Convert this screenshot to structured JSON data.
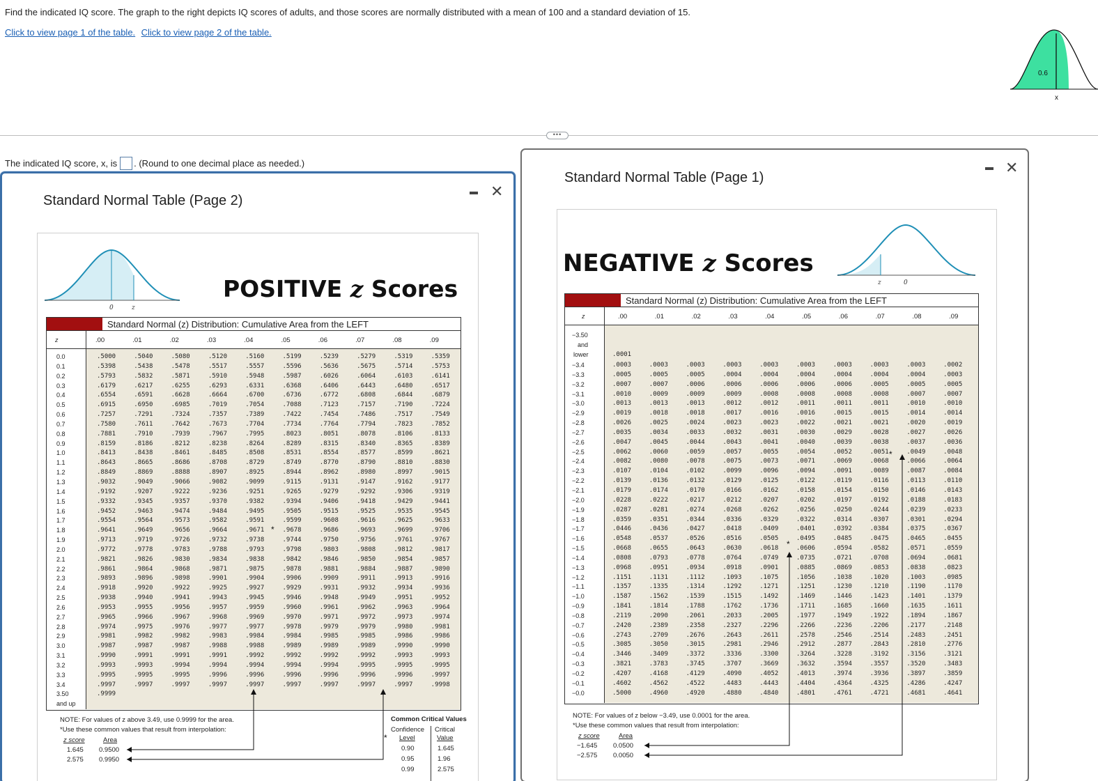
{
  "question": {
    "text": "Find the indicated IQ score. The graph to the right depicts IQ scores of adults, and those scores are normally distributed with a mean of 100 and a standard deviation of 15.",
    "link1": "Click to view page 1 of the table.",
    "link2": "Click to view page 2 of the table.",
    "graph_area_label": "0.6",
    "graph_x_label": "x",
    "answer_prefix": "The indicated IQ score, x, is",
    "answer_suffix": ". (Round to one decimal place as needed.)",
    "more_label": "•••"
  },
  "colors": {
    "accent_green": "#3de0a0",
    "link_blue": "#1a5fb4",
    "band_red": "#a20f10",
    "curve_blue": "#1f8fb6"
  },
  "page2": {
    "title": "Standard Normal Table (Page 2)",
    "heading_word": "POSITIVE",
    "heading_z": "z",
    "heading_tail": "Scores",
    "band_text": "Standard Normal (z) Distribution: Cumulative Area from the LEFT",
    "curve_label_0": "0",
    "curve_label_z": "z",
    "z_header": "z",
    "col_headers": [
      ".00",
      ".01",
      ".02",
      ".03",
      ".04",
      ".05",
      ".06",
      ".07",
      ".08",
      ".09"
    ],
    "z_values": [
      "0.0",
      "0.1",
      "0.2",
      "0.3",
      "0.4",
      "0.5",
      "0.6",
      "0.7",
      "0.8",
      "0.9",
      "1.0",
      "1.1",
      "1.2",
      "1.3",
      "1.4",
      "1.5",
      "1.6",
      "1.7",
      "1.8",
      "1.9",
      "2.0",
      "2.1",
      "2.2",
      "2.3",
      "2.4",
      "2.5",
      "2.6",
      "2.7",
      "2.8",
      "2.9",
      "3.0",
      "3.1",
      "3.2",
      "3.3",
      "3.4"
    ],
    "rows": [
      [
        ".5000",
        ".5040",
        ".5080",
        ".5120",
        ".5160",
        ".5199",
        ".5239",
        ".5279",
        ".5319",
        ".5359"
      ],
      [
        ".5398",
        ".5438",
        ".5478",
        ".5517",
        ".5557",
        ".5596",
        ".5636",
        ".5675",
        ".5714",
        ".5753"
      ],
      [
        ".5793",
        ".5832",
        ".5871",
        ".5910",
        ".5948",
        ".5987",
        ".6026",
        ".6064",
        ".6103",
        ".6141"
      ],
      [
        ".6179",
        ".6217",
        ".6255",
        ".6293",
        ".6331",
        ".6368",
        ".6406",
        ".6443",
        ".6480",
        ".6517"
      ],
      [
        ".6554",
        ".6591",
        ".6628",
        ".6664",
        ".6700",
        ".6736",
        ".6772",
        ".6808",
        ".6844",
        ".6879"
      ],
      [
        ".6915",
        ".6950",
        ".6985",
        ".7019",
        ".7054",
        ".7088",
        ".7123",
        ".7157",
        ".7190",
        ".7224"
      ],
      [
        ".7257",
        ".7291",
        ".7324",
        ".7357",
        ".7389",
        ".7422",
        ".7454",
        ".7486",
        ".7517",
        ".7549"
      ],
      [
        ".7580",
        ".7611",
        ".7642",
        ".7673",
        ".7704",
        ".7734",
        ".7764",
        ".7794",
        ".7823",
        ".7852"
      ],
      [
        ".7881",
        ".7910",
        ".7939",
        ".7967",
        ".7995",
        ".8023",
        ".8051",
        ".8078",
        ".8106",
        ".8133"
      ],
      [
        ".8159",
        ".8186",
        ".8212",
        ".8238",
        ".8264",
        ".8289",
        ".8315",
        ".8340",
        ".8365",
        ".8389"
      ],
      [
        ".8413",
        ".8438",
        ".8461",
        ".8485",
        ".8508",
        ".8531",
        ".8554",
        ".8577",
        ".8599",
        ".8621"
      ],
      [
        ".8643",
        ".8665",
        ".8686",
        ".8708",
        ".8729",
        ".8749",
        ".8770",
        ".8790",
        ".8810",
        ".8830"
      ],
      [
        ".8849",
        ".8869",
        ".8888",
        ".8907",
        ".8925",
        ".8944",
        ".8962",
        ".8980",
        ".8997",
        ".9015"
      ],
      [
        ".9032",
        ".9049",
        ".9066",
        ".9082",
        ".9099",
        ".9115",
        ".9131",
        ".9147",
        ".9162",
        ".9177"
      ],
      [
        ".9192",
        ".9207",
        ".9222",
        ".9236",
        ".9251",
        ".9265",
        ".9279",
        ".9292",
        ".9306",
        ".9319"
      ],
      [
        ".9332",
        ".9345",
        ".9357",
        ".9370",
        ".9382",
        ".9394",
        ".9406",
        ".9418",
        ".9429",
        ".9441"
      ],
      [
        ".9452",
        ".9463",
        ".9474",
        ".9484",
        ".9495",
        ".9505",
        ".9515",
        ".9525",
        ".9535",
        ".9545"
      ],
      [
        ".9554",
        ".9564",
        ".9573",
        ".9582",
        ".9591",
        ".9599",
        ".9608",
        ".9616",
        ".9625",
        ".9633"
      ],
      [
        ".9641",
        ".9649",
        ".9656",
        ".9664",
        ".9671",
        ".9678",
        ".9686",
        ".9693",
        ".9699",
        ".9706"
      ],
      [
        ".9713",
        ".9719",
        ".9726",
        ".9732",
        ".9738",
        ".9744",
        ".9750",
        ".9756",
        ".9761",
        ".9767"
      ],
      [
        ".9772",
        ".9778",
        ".9783",
        ".9788",
        ".9793",
        ".9798",
        ".9803",
        ".9808",
        ".9812",
        ".9817"
      ],
      [
        ".9821",
        ".9826",
        ".9830",
        ".9834",
        ".9838",
        ".9842",
        ".9846",
        ".9850",
        ".9854",
        ".9857"
      ],
      [
        ".9861",
        ".9864",
        ".9868",
        ".9871",
        ".9875",
        ".9878",
        ".9881",
        ".9884",
        ".9887",
        ".9890"
      ],
      [
        ".9893",
        ".9896",
        ".9898",
        ".9901",
        ".9904",
        ".9906",
        ".9909",
        ".9911",
        ".9913",
        ".9916"
      ],
      [
        ".9918",
        ".9920",
        ".9922",
        ".9925",
        ".9927",
        ".9929",
        ".9931",
        ".9932",
        ".9934",
        ".9936"
      ],
      [
        ".9938",
        ".9940",
        ".9941",
        ".9943",
        ".9945",
        ".9946",
        ".9948",
        ".9949",
        ".9951",
        ".9952"
      ],
      [
        ".9953",
        ".9955",
        ".9956",
        ".9957",
        ".9959",
        ".9960",
        ".9961",
        ".9962",
        ".9963",
        ".9964"
      ],
      [
        ".9965",
        ".9966",
        ".9967",
        ".9968",
        ".9969",
        ".9970",
        ".9971",
        ".9972",
        ".9973",
        ".9974"
      ],
      [
        ".9974",
        ".9975",
        ".9976",
        ".9977",
        ".9977",
        ".9978",
        ".9979",
        ".9979",
        ".9980",
        ".9981"
      ],
      [
        ".9981",
        ".9982",
        ".9982",
        ".9983",
        ".9984",
        ".9984",
        ".9985",
        ".9985",
        ".9986",
        ".9986"
      ],
      [
        ".9987",
        ".9987",
        ".9987",
        ".9988",
        ".9988",
        ".9989",
        ".9989",
        ".9989",
        ".9990",
        ".9990"
      ],
      [
        ".9990",
        ".9991",
        ".9991",
        ".9991",
        ".9992",
        ".9992",
        ".9992",
        ".9992",
        ".9993",
        ".9993"
      ],
      [
        ".9993",
        ".9993",
        ".9994",
        ".9994",
        ".9994",
        ".9994",
        ".9994",
        ".9995",
        ".9995",
        ".9995"
      ],
      [
        ".9995",
        ".9995",
        ".9995",
        ".9996",
        ".9996",
        ".9996",
        ".9996",
        ".9996",
        ".9996",
        ".9997"
      ],
      [
        ".9997",
        ".9997",
        ".9997",
        ".9997",
        ".9997",
        ".9997",
        ".9997",
        ".9997",
        ".9997",
        ".9998"
      ]
    ],
    "last_z": "3.50",
    "last_z2": "and up",
    "last_value": ".9999",
    "note": "NOTE: For values of z above 3.49, use 0.9999 for the area.",
    "note2": "*Use these common values that result from interpolation:",
    "interp_header_z": "z score",
    "interp_header_area": "Area",
    "interp": [
      [
        "1.645",
        "0.9500"
      ],
      [
        "2.575",
        "0.9950"
      ]
    ],
    "ccv_title": "Common Critical Values",
    "ccv_h1": "Confidence",
    "ccv_h1b": "Level",
    "ccv_h2": "Critical",
    "ccv_h2b": "Value",
    "ccv": [
      [
        "0.90",
        "1.645"
      ],
      [
        "0.95",
        "1.96"
      ],
      [
        "0.99",
        "2.575"
      ]
    ]
  },
  "page1": {
    "title": "Standard Normal Table (Page 1)",
    "heading_word": "NEGATIVE",
    "heading_z": "z",
    "heading_tail": "Scores",
    "band_text": "Standard Normal (z) Distribution: Cumulative Area from the LEFT",
    "curve_label_z": "z",
    "curve_label_0": "0",
    "z_header": "z",
    "col_headers": [
      ".00",
      ".01",
      ".02",
      ".03",
      ".04",
      ".05",
      ".06",
      ".07",
      ".08",
      ".09"
    ],
    "first_z": "−3.50",
    "first_z2": "and",
    "first_z3": "lower",
    "first_value": ".0001",
    "z_values": [
      "−3.4",
      "−3.3",
      "−3.2",
      "−3.1",
      "−3.0",
      "−2.9",
      "−2.8",
      "−2.7",
      "−2.6",
      "−2.5",
      "−2.4",
      "−2.3",
      "−2.2",
      "−2.1",
      "−2.0",
      "−1.9",
      "−1.8",
      "−1.7",
      "−1.6",
      "−1.5",
      "−1.4",
      "−1.3",
      "−1.2",
      "−1.1",
      "−1.0",
      "−0.9",
      "−0.8",
      "−0.7",
      "−0.6",
      "−0.5",
      "−0.4",
      "−0.3",
      "−0.2",
      "−0.1",
      "−0.0"
    ],
    "rows": [
      [
        ".0003",
        ".0003",
        ".0003",
        ".0003",
        ".0003",
        ".0003",
        ".0003",
        ".0003",
        ".0003",
        ".0002"
      ],
      [
        ".0005",
        ".0005",
        ".0005",
        ".0004",
        ".0004",
        ".0004",
        ".0004",
        ".0004",
        ".0004",
        ".0003"
      ],
      [
        ".0007",
        ".0007",
        ".0006",
        ".0006",
        ".0006",
        ".0006",
        ".0006",
        ".0005",
        ".0005",
        ".0005"
      ],
      [
        ".0010",
        ".0009",
        ".0009",
        ".0009",
        ".0008",
        ".0008",
        ".0008",
        ".0008",
        ".0007",
        ".0007"
      ],
      [
        ".0013",
        ".0013",
        ".0013",
        ".0012",
        ".0012",
        ".0011",
        ".0011",
        ".0011",
        ".0010",
        ".0010"
      ],
      [
        ".0019",
        ".0018",
        ".0018",
        ".0017",
        ".0016",
        ".0016",
        ".0015",
        ".0015",
        ".0014",
        ".0014"
      ],
      [
        ".0026",
        ".0025",
        ".0024",
        ".0023",
        ".0023",
        ".0022",
        ".0021",
        ".0021",
        ".0020",
        ".0019"
      ],
      [
        ".0035",
        ".0034",
        ".0033",
        ".0032",
        ".0031",
        ".0030",
        ".0029",
        ".0028",
        ".0027",
        ".0026"
      ],
      [
        ".0047",
        ".0045",
        ".0044",
        ".0043",
        ".0041",
        ".0040",
        ".0039",
        ".0038",
        ".0037",
        ".0036"
      ],
      [
        ".0062",
        ".0060",
        ".0059",
        ".0057",
        ".0055",
        ".0054",
        ".0052",
        ".0051",
        ".0049",
        ".0048"
      ],
      [
        ".0082",
        ".0080",
        ".0078",
        ".0075",
        ".0073",
        ".0071",
        ".0069",
        ".0068",
        ".0066",
        ".0064"
      ],
      [
        ".0107",
        ".0104",
        ".0102",
        ".0099",
        ".0096",
        ".0094",
        ".0091",
        ".0089",
        ".0087",
        ".0084"
      ],
      [
        ".0139",
        ".0136",
        ".0132",
        ".0129",
        ".0125",
        ".0122",
        ".0119",
        ".0116",
        ".0113",
        ".0110"
      ],
      [
        ".0179",
        ".0174",
        ".0170",
        ".0166",
        ".0162",
        ".0158",
        ".0154",
        ".0150",
        ".0146",
        ".0143"
      ],
      [
        ".0228",
        ".0222",
        ".0217",
        ".0212",
        ".0207",
        ".0202",
        ".0197",
        ".0192",
        ".0188",
        ".0183"
      ],
      [
        ".0287",
        ".0281",
        ".0274",
        ".0268",
        ".0262",
        ".0256",
        ".0250",
        ".0244",
        ".0239",
        ".0233"
      ],
      [
        ".0359",
        ".0351",
        ".0344",
        ".0336",
        ".0329",
        ".0322",
        ".0314",
        ".0307",
        ".0301",
        ".0294"
      ],
      [
        ".0446",
        ".0436",
        ".0427",
        ".0418",
        ".0409",
        ".0401",
        ".0392",
        ".0384",
        ".0375",
        ".0367"
      ],
      [
        ".0548",
        ".0537",
        ".0526",
        ".0516",
        ".0505",
        ".0495",
        ".0485",
        ".0475",
        ".0465",
        ".0455"
      ],
      [
        ".0668",
        ".0655",
        ".0643",
        ".0630",
        ".0618",
        ".0606",
        ".0594",
        ".0582",
        ".0571",
        ".0559"
      ],
      [
        ".0808",
        ".0793",
        ".0778",
        ".0764",
        ".0749",
        ".0735",
        ".0721",
        ".0708",
        ".0694",
        ".0681"
      ],
      [
        ".0968",
        ".0951",
        ".0934",
        ".0918",
        ".0901",
        ".0885",
        ".0869",
        ".0853",
        ".0838",
        ".0823"
      ],
      [
        ".1151",
        ".1131",
        ".1112",
        ".1093",
        ".1075",
        ".1056",
        ".1038",
        ".1020",
        ".1003",
        ".0985"
      ],
      [
        ".1357",
        ".1335",
        ".1314",
        ".1292",
        ".1271",
        ".1251",
        ".1230",
        ".1210",
        ".1190",
        ".1170"
      ],
      [
        ".1587",
        ".1562",
        ".1539",
        ".1515",
        ".1492",
        ".1469",
        ".1446",
        ".1423",
        ".1401",
        ".1379"
      ],
      [
        ".1841",
        ".1814",
        ".1788",
        ".1762",
        ".1736",
        ".1711",
        ".1685",
        ".1660",
        ".1635",
        ".1611"
      ],
      [
        ".2119",
        ".2090",
        ".2061",
        ".2033",
        ".2005",
        ".1977",
        ".1949",
        ".1922",
        ".1894",
        ".1867"
      ],
      [
        ".2420",
        ".2389",
        ".2358",
        ".2327",
        ".2296",
        ".2266",
        ".2236",
        ".2206",
        ".2177",
        ".2148"
      ],
      [
        ".2743",
        ".2709",
        ".2676",
        ".2643",
        ".2611",
        ".2578",
        ".2546",
        ".2514",
        ".2483",
        ".2451"
      ],
      [
        ".3085",
        ".3050",
        ".3015",
        ".2981",
        ".2946",
        ".2912",
        ".2877",
        ".2843",
        ".2810",
        ".2776"
      ],
      [
        ".3446",
        ".3409",
        ".3372",
        ".3336",
        ".3300",
        ".3264",
        ".3228",
        ".3192",
        ".3156",
        ".3121"
      ],
      [
        ".3821",
        ".3783",
        ".3745",
        ".3707",
        ".3669",
        ".3632",
        ".3594",
        ".3557",
        ".3520",
        ".3483"
      ],
      [
        ".4207",
        ".4168",
        ".4129",
        ".4090",
        ".4052",
        ".4013",
        ".3974",
        ".3936",
        ".3897",
        ".3859"
      ],
      [
        ".4602",
        ".4562",
        ".4522",
        ".4483",
        ".4443",
        ".4404",
        ".4364",
        ".4325",
        ".4286",
        ".4247"
      ],
      [
        ".5000",
        ".4960",
        ".4920",
        ".4880",
        ".4840",
        ".4801",
        ".4761",
        ".4721",
        ".4681",
        ".4641"
      ]
    ],
    "note": "NOTE: For values of z below −3.49, use 0.0001 for the area.",
    "note2": "*Use these common values that result from interpolation:",
    "interp_header_z": "z score",
    "interp_header_area": "Area",
    "interp": [
      [
        "−1.645",
        "0.0500"
      ],
      [
        "−2.575",
        "0.0050"
      ]
    ]
  }
}
